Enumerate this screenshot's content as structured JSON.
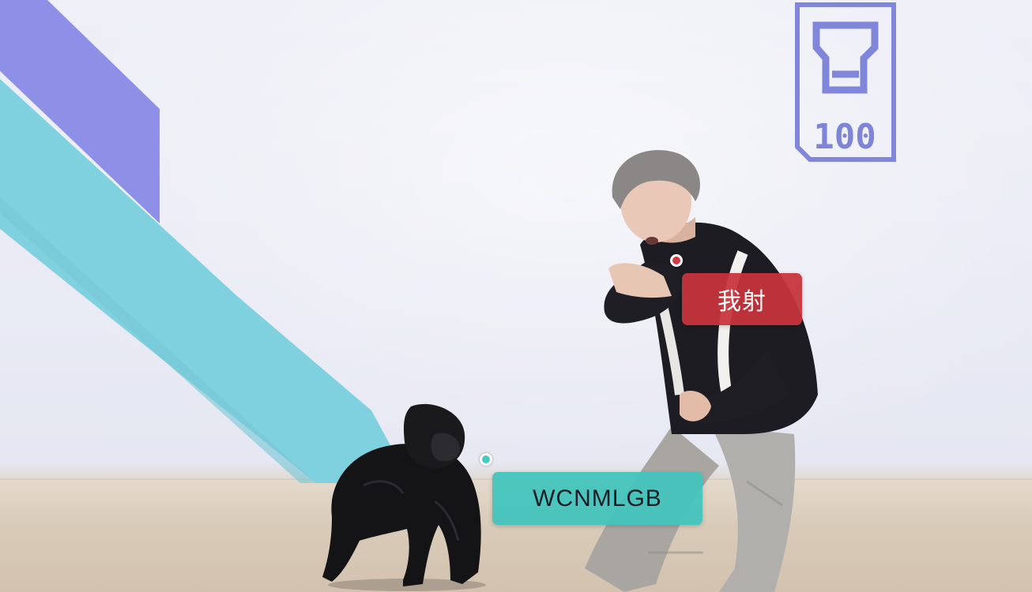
{
  "scene": {
    "logo_text": "100",
    "colors": {
      "purple_band": "#8c8ee6",
      "cyan_band": "#7ed0df",
      "logo_color": "#7e84d8",
      "tag_red": "#c8343c",
      "tag_teal": "#42c4bc"
    }
  },
  "tags": [
    {
      "text": "我射",
      "color": "red"
    },
    {
      "text": "WCNMLGB",
      "color": "teal"
    }
  ]
}
